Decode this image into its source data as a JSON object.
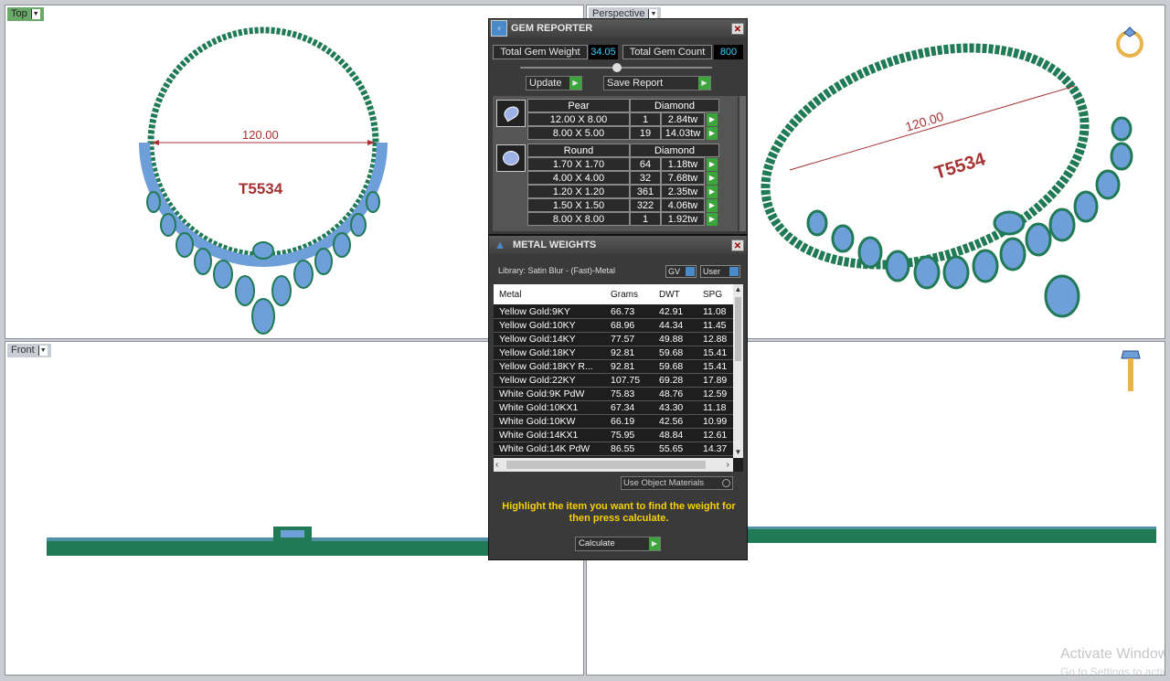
{
  "viewports": {
    "top_label": "Top",
    "perspective_label": "Perspective",
    "front_label": "Front"
  },
  "annotations": {
    "dimension": "120.00",
    "item_code": "T5534"
  },
  "gem_reporter": {
    "title": "GEM REPORTER",
    "total_weight_label": "Total Gem Weight",
    "total_weight_value": "34.05",
    "total_count_label": "Total Gem Count",
    "total_count_value": "800",
    "update_label": "Update",
    "save_report_label": "Save Report",
    "groups": [
      {
        "shape": "Pear",
        "material": "Diamond",
        "rows": [
          {
            "size": "12.00 X 8.00",
            "count": "1",
            "weight": "2.84tw"
          },
          {
            "size": "8.00 X 5.00",
            "count": "19",
            "weight": "14.03tw"
          }
        ]
      },
      {
        "shape": "Round",
        "material": "Diamond",
        "rows": [
          {
            "size": "1.70 X 1.70",
            "count": "64",
            "weight": "1.18tw"
          },
          {
            "size": "4.00 X 4.00",
            "count": "32",
            "weight": "7.68tw"
          },
          {
            "size": "1.20 X 1.20",
            "count": "361",
            "weight": "2.35tw"
          },
          {
            "size": "1.50 X 1.50",
            "count": "322",
            "weight": "4.06tw"
          },
          {
            "size": "8.00 X 8.00",
            "count": "1",
            "weight": "1.92tw"
          }
        ]
      }
    ]
  },
  "metal_weights": {
    "title": "METAL WEIGHTS",
    "library": "Library: Satin Blur - (Fast)-Metal",
    "gv_label": "GV",
    "user_label": "User",
    "columns": [
      "Metal",
      "Grams",
      "DWT",
      "SPG"
    ],
    "rows": [
      [
        "Yellow Gold:9KY",
        "66.73",
        "42.91",
        "11.08"
      ],
      [
        "Yellow Gold:10KY",
        "68.96",
        "44.34",
        "11.45"
      ],
      [
        "Yellow Gold:14KY",
        "77.57",
        "49.88",
        "12.88"
      ],
      [
        "Yellow Gold:18KY",
        "92.81",
        "59.68",
        "15.41"
      ],
      [
        "Yellow Gold:18KY R...",
        "92.81",
        "59.68",
        "15.41"
      ],
      [
        "Yellow Gold:22KY",
        "107.75",
        "69.28",
        "17.89"
      ],
      [
        "White Gold:9K PdW",
        "75.83",
        "48.76",
        "12.59"
      ],
      [
        "White Gold:10KX1",
        "67.34",
        "43.30",
        "11.18"
      ],
      [
        "White Gold:10KW",
        "66.19",
        "42.56",
        "10.99"
      ],
      [
        "White Gold:14KX1",
        "75.95",
        "48.84",
        "12.61"
      ],
      [
        "White Gold:14K PdW",
        "86.55",
        "55.65",
        "14.37"
      ]
    ],
    "use_object_materials": "Use Object Materials",
    "instruction": "Highlight the item you want to find the weight for then press calculate.",
    "calculate_label": "Calculate"
  },
  "watermark": {
    "line1": "Activate Windows",
    "line2": "Go to Settings to activate Windows."
  },
  "colors": {
    "gem": "#6f9fd8",
    "metal": "#1f7a55",
    "text_red": "#a83232",
    "panel_bg": "#3a3a3a",
    "button_green": "#3ca53c"
  }
}
